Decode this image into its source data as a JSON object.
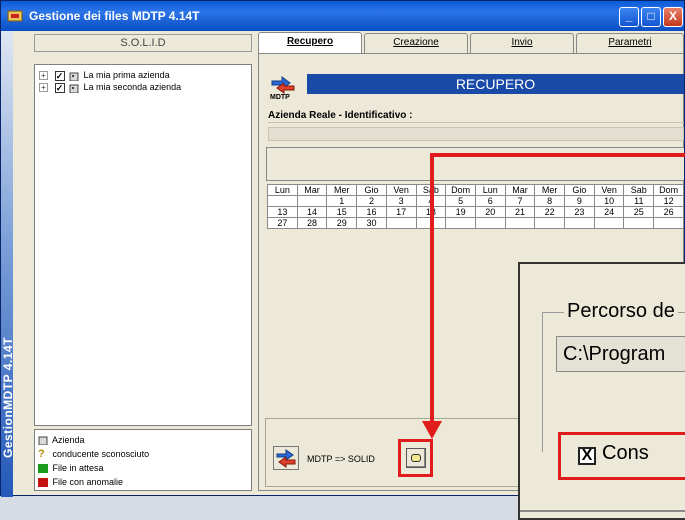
{
  "window": {
    "title": "Gestione dei files MDTP 4.14T",
    "side_banner": "GestionMDTP 4.14T",
    "buttons": {
      "minimize": "_",
      "maximize": "□",
      "close": "X"
    }
  },
  "left_pane": {
    "header": "S.O.L.I.D",
    "tree": [
      {
        "label": "La mia prima azienda",
        "checked": true,
        "expander": "+"
      },
      {
        "label": "La mia seconda azienda",
        "checked": true,
        "expander": "+"
      }
    ],
    "legend": [
      {
        "label": "Azienda",
        "icon": "building-icon"
      },
      {
        "label": "conducente sconosciuto",
        "icon": "question-icon"
      },
      {
        "label": "File in attesa",
        "icon": "green-folder-icon",
        "color": "#1a9a1a"
      },
      {
        "label": "File con anomalie",
        "icon": "red-folder-icon",
        "color": "#c21414"
      }
    ]
  },
  "tabs": [
    {
      "label": "Recupero",
      "active": true
    },
    {
      "label": "Creazione",
      "active": false
    },
    {
      "label": "Invio",
      "active": false
    },
    {
      "label": "Parametri",
      "active": false
    }
  ],
  "recupero": {
    "logo_text": "MDTP",
    "banner": "RECUPERO",
    "azienda_label": "Azienda Reale - Identificativo :",
    "calendar": {
      "headers": [
        "Lun",
        "Mar",
        "Mer",
        "Gio",
        "Ven",
        "Sab",
        "Dom",
        "Lun",
        "Mar",
        "Mer",
        "Gio",
        "Ven",
        "Sab",
        "Dom"
      ],
      "rows": [
        [
          "",
          "",
          "1",
          "2",
          "3",
          "4",
          "5",
          "6",
          "7",
          "8",
          "9",
          "10",
          "11",
          "12"
        ],
        [
          "13",
          "14",
          "15",
          "16",
          "17",
          "18",
          "19",
          "20",
          "21",
          "22",
          "23",
          "24",
          "25",
          "26"
        ],
        [
          "27",
          "28",
          "29",
          "30",
          "",
          "",
          "",
          "",
          "",
          "",
          "",
          "",
          "",
          ""
        ]
      ]
    },
    "transfer_label": "MDTP => SOLID"
  },
  "zoom": {
    "group_label": "Percorso de",
    "path_value": "C:\\Program",
    "checkbox_label": "Cons",
    "checkbox_mark": "X"
  },
  "colors": {
    "accent": "#e01c1c",
    "banner": "#1a4aa8",
    "title_bar": "#0b5ad8"
  }
}
